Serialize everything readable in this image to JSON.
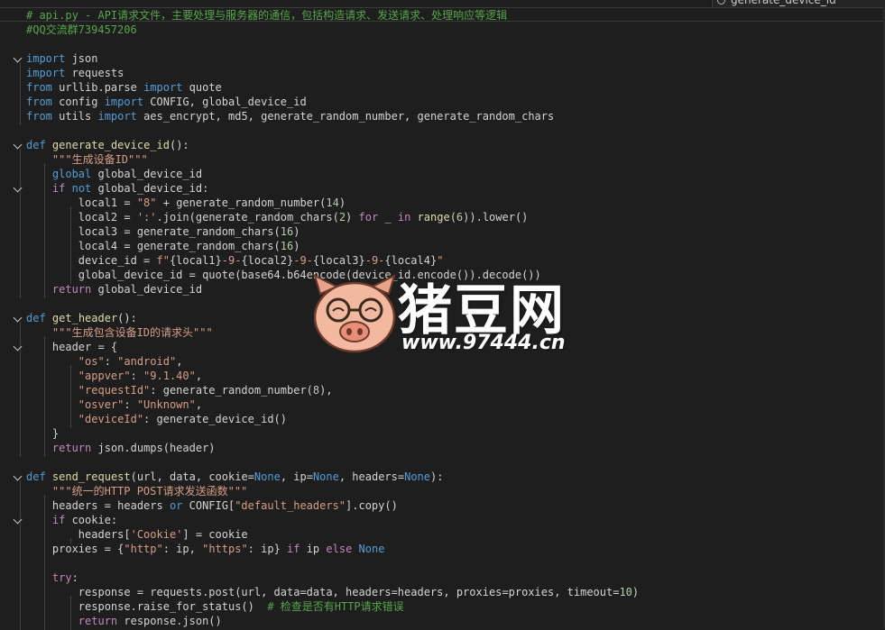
{
  "tab": {
    "title": "generate_device_id"
  },
  "lines": [
    [
      {
        "t": "# api.py - API请求文件，主要处理与服务器的通信，包括构造请求、发送请求、处理响应等逻辑",
        "c": "com"
      }
    ],
    [
      {
        "t": "#QQ交流群739457206",
        "c": "com"
      }
    ],
    [],
    [
      {
        "t": "import",
        "c": "kw"
      },
      {
        "t": " json"
      }
    ],
    [
      {
        "t": "import",
        "c": "kw"
      },
      {
        "t": " requests"
      }
    ],
    [
      {
        "t": "from",
        "c": "kw"
      },
      {
        "t": " urllib.parse "
      },
      {
        "t": "import",
        "c": "kw"
      },
      {
        "t": " quote"
      }
    ],
    [
      {
        "t": "from",
        "c": "kw"
      },
      {
        "t": " config "
      },
      {
        "t": "import",
        "c": "kw"
      },
      {
        "t": " CONFIG, global_device_id"
      }
    ],
    [
      {
        "t": "from",
        "c": "kw"
      },
      {
        "t": " utils "
      },
      {
        "t": "import",
        "c": "kw"
      },
      {
        "t": " aes_encrypt, md5, generate_random_number, generate_random_chars"
      }
    ],
    [],
    [
      {
        "t": "def",
        "c": "kw"
      },
      {
        "t": " "
      },
      {
        "t": "generate_device_id",
        "c": "fn"
      },
      {
        "t": "():"
      }
    ],
    [
      {
        "t": "    "
      },
      {
        "t": "\"\"\"生成设备ID\"\"\"",
        "c": "str"
      }
    ],
    [
      {
        "t": "    "
      },
      {
        "t": "global",
        "c": "kw"
      },
      {
        "t": " global_device_id"
      }
    ],
    [
      {
        "t": "    "
      },
      {
        "t": "if",
        "c": "ctl"
      },
      {
        "t": " "
      },
      {
        "t": "not",
        "c": "kw"
      },
      {
        "t": " global_device_id:"
      }
    ],
    [
      {
        "t": "        local1 = "
      },
      {
        "t": "\"8\"",
        "c": "str"
      },
      {
        "t": " + generate_random_number("
      },
      {
        "t": "14",
        "c": "num"
      },
      {
        "t": ")"
      }
    ],
    [
      {
        "t": "        local2 = "
      },
      {
        "t": "':'",
        "c": "str"
      },
      {
        "t": ".join(generate_random_chars("
      },
      {
        "t": "2",
        "c": "num"
      },
      {
        "t": ") "
      },
      {
        "t": "for",
        "c": "ctl"
      },
      {
        "t": " _ "
      },
      {
        "t": "in",
        "c": "ctl"
      },
      {
        "t": " "
      },
      {
        "t": "range",
        "c": "fn"
      },
      {
        "t": "("
      },
      {
        "t": "6",
        "c": "num"
      },
      {
        "t": ")).lower()"
      }
    ],
    [
      {
        "t": "        local3 = generate_random_chars("
      },
      {
        "t": "16",
        "c": "num"
      },
      {
        "t": ")"
      }
    ],
    [
      {
        "t": "        local4 = generate_random_chars("
      },
      {
        "t": "16",
        "c": "num"
      },
      {
        "t": ")"
      }
    ],
    [
      {
        "t": "        device_id = "
      },
      {
        "t": "f\"",
        "c": "str"
      },
      {
        "t": "{local1}"
      },
      {
        "t": "-9-",
        "c": "str"
      },
      {
        "t": "{local2}"
      },
      {
        "t": "-9-",
        "c": "str"
      },
      {
        "t": "{local3}"
      },
      {
        "t": "-9-",
        "c": "str"
      },
      {
        "t": "{local4}"
      },
      {
        "t": "\"",
        "c": "str"
      }
    ],
    [
      {
        "t": "        global_device_id = quote(base64.b64encode(device_id.encode()).decode())"
      }
    ],
    [
      {
        "t": "    "
      },
      {
        "t": "return",
        "c": "ctl"
      },
      {
        "t": " global_device_id"
      }
    ],
    [],
    [
      {
        "t": "def",
        "c": "kw"
      },
      {
        "t": " "
      },
      {
        "t": "get_header",
        "c": "fn"
      },
      {
        "t": "():"
      }
    ],
    [
      {
        "t": "    "
      },
      {
        "t": "\"\"\"生成包含设备ID的请求头\"\"\"",
        "c": "str"
      }
    ],
    [
      {
        "t": "    header = {"
      }
    ],
    [
      {
        "t": "        "
      },
      {
        "t": "\"os\"",
        "c": "str"
      },
      {
        "t": ": "
      },
      {
        "t": "\"android\"",
        "c": "str"
      },
      {
        "t": ","
      }
    ],
    [
      {
        "t": "        "
      },
      {
        "t": "\"appver\"",
        "c": "str"
      },
      {
        "t": ": "
      },
      {
        "t": "\"9.1.40\"",
        "c": "str"
      },
      {
        "t": ","
      }
    ],
    [
      {
        "t": "        "
      },
      {
        "t": "\"requestId\"",
        "c": "str"
      },
      {
        "t": ": generate_random_number("
      },
      {
        "t": "8",
        "c": "num"
      },
      {
        "t": "),"
      }
    ],
    [
      {
        "t": "        "
      },
      {
        "t": "\"osver\"",
        "c": "str"
      },
      {
        "t": ": "
      },
      {
        "t": "\"Unknown\"",
        "c": "str"
      },
      {
        "t": ","
      }
    ],
    [
      {
        "t": "        "
      },
      {
        "t": "\"deviceId\"",
        "c": "str"
      },
      {
        "t": ": generate_device_id()"
      }
    ],
    [
      {
        "t": "    }"
      }
    ],
    [
      {
        "t": "    "
      },
      {
        "t": "return",
        "c": "ctl"
      },
      {
        "t": " json.dumps(header)"
      }
    ],
    [],
    [
      {
        "t": "def",
        "c": "kw"
      },
      {
        "t": " "
      },
      {
        "t": "send_request",
        "c": "fn"
      },
      {
        "t": "(url, data, cookie="
      },
      {
        "t": "None",
        "c": "kw"
      },
      {
        "t": ", ip="
      },
      {
        "t": "None",
        "c": "kw"
      },
      {
        "t": ", headers="
      },
      {
        "t": "None",
        "c": "kw"
      },
      {
        "t": "):"
      }
    ],
    [
      {
        "t": "    "
      },
      {
        "t": "\"\"\"统一的HTTP POST请求发送函数\"\"\"",
        "c": "str"
      }
    ],
    [
      {
        "t": "    headers = headers "
      },
      {
        "t": "or",
        "c": "kw"
      },
      {
        "t": " CONFIG["
      },
      {
        "t": "\"default_headers\"",
        "c": "str"
      },
      {
        "t": "].copy()"
      }
    ],
    [
      {
        "t": "    "
      },
      {
        "t": "if",
        "c": "ctl"
      },
      {
        "t": " cookie:"
      }
    ],
    [
      {
        "t": "        headers["
      },
      {
        "t": "'Cookie'",
        "c": "str"
      },
      {
        "t": "] = cookie"
      }
    ],
    [
      {
        "t": "    proxies = {"
      },
      {
        "t": "\"http\"",
        "c": "str"
      },
      {
        "t": ": ip, "
      },
      {
        "t": "\"https\"",
        "c": "str"
      },
      {
        "t": ": ip} "
      },
      {
        "t": "if",
        "c": "ctl"
      },
      {
        "t": " ip "
      },
      {
        "t": "else",
        "c": "ctl"
      },
      {
        "t": " "
      },
      {
        "t": "None",
        "c": "kw"
      }
    ],
    [],
    [
      {
        "t": "    "
      },
      {
        "t": "try",
        "c": "ctl"
      },
      {
        "t": ":"
      }
    ],
    [
      {
        "t": "        response = requests.post(url, data=data, headers=headers, proxies=proxies, timeout="
      },
      {
        "t": "10",
        "c": "num"
      },
      {
        "t": ")"
      }
    ],
    [
      {
        "t": "        response.raise_for_status()  "
      },
      {
        "t": "# 检查是否有HTTP请求错误",
        "c": "com"
      }
    ],
    [
      {
        "t": "        "
      },
      {
        "t": "return",
        "c": "ctl"
      },
      {
        "t": " response.json()"
      }
    ]
  ],
  "watermark": {
    "title": "猪豆网",
    "url": "www.97444.cn"
  }
}
